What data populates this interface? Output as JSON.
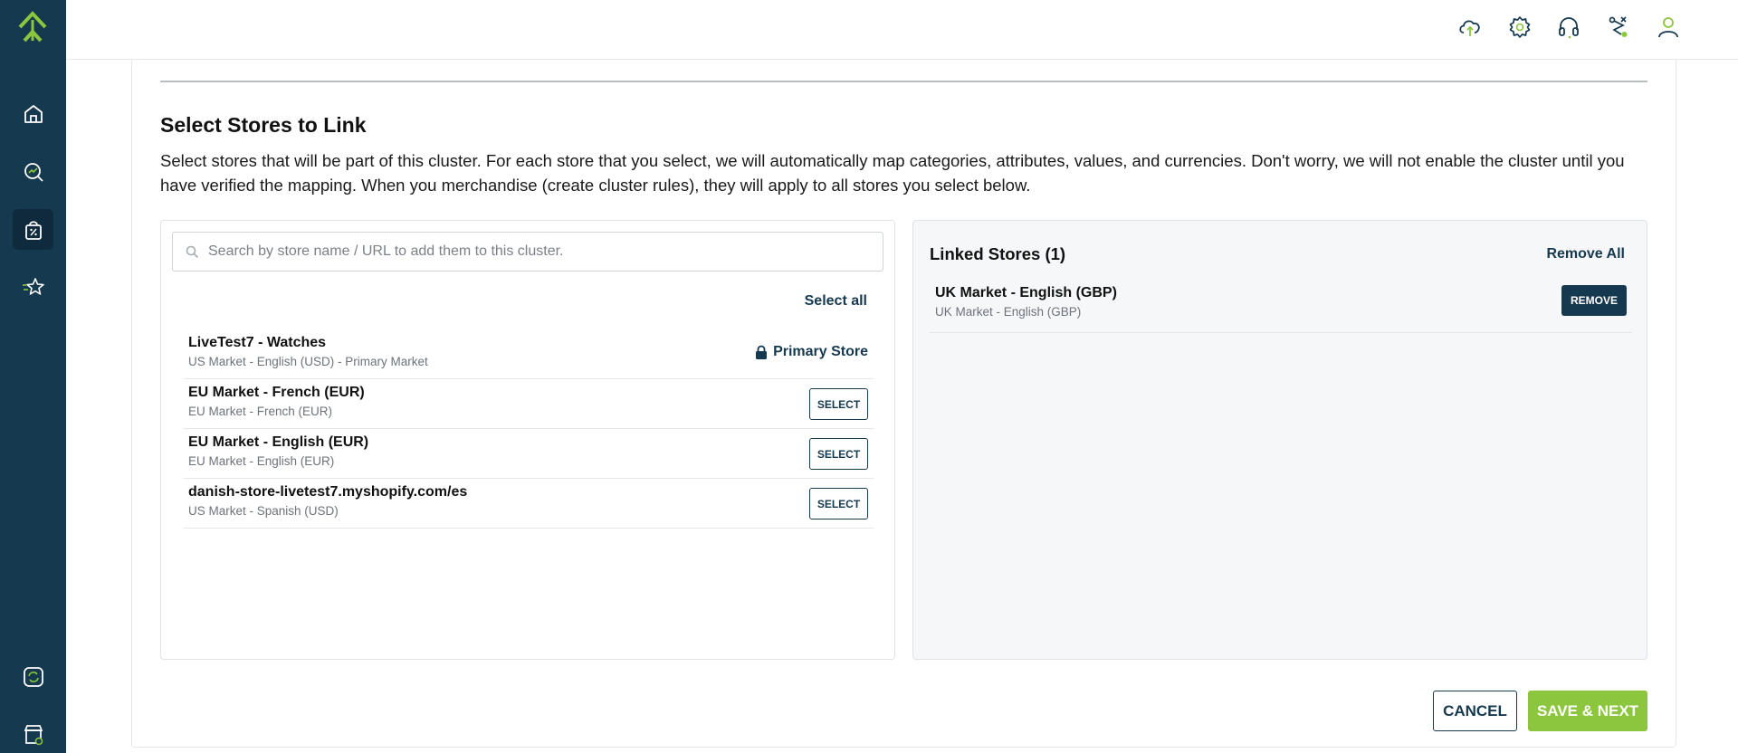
{
  "colors": {
    "sidebar_bg": "#15394f",
    "accent_green": "#8cc63f",
    "primary_dark": "#15394f"
  },
  "sidebar": {
    "logo": "chevron-up-logo-icon",
    "items": [
      {
        "icon": "home-icon",
        "active": false
      },
      {
        "icon": "analytics-search-icon",
        "active": false
      },
      {
        "icon": "shopping-bag-percent-icon",
        "active": true
      },
      {
        "icon": "star-list-icon",
        "active": false
      },
      {
        "icon": "sync-icon",
        "active": false
      },
      {
        "icon": "store-settings-icon",
        "active": false
      }
    ]
  },
  "header": {
    "icons": [
      "cloud-upload-icon",
      "gear-icon",
      "headset-icon",
      "route-icon",
      "user-icon"
    ]
  },
  "main": {
    "title": "Select Stores to Link",
    "description": "Select stores that will be part of this cluster. For each store that you select, we will automatically map categories, attributes, values, and currencies. Don't worry, we will not enable the cluster until you have verified the mapping. When you merchandise (create cluster rules), they will apply to all stores you select below."
  },
  "available": {
    "search_placeholder": "Search by store name / URL to add them to this cluster.",
    "select_all_label": "Select all",
    "primary_label": "Primary Store",
    "select_label": "SELECT",
    "stores": [
      {
        "name": "LiveTest7 - Watches",
        "sub": "US Market - English (USD) - Primary Market",
        "primary": true
      },
      {
        "name": "EU Market - French (EUR)",
        "sub": "EU Market - French (EUR)",
        "primary": false
      },
      {
        "name": "EU Market - English (EUR)",
        "sub": "EU Market - English (EUR)",
        "primary": false
      },
      {
        "name": "danish-store-livetest7.myshopify.com/es",
        "sub": "US Market - Spanish (USD)",
        "primary": false
      }
    ]
  },
  "linked": {
    "title": "Linked Stores (1)",
    "remove_all_label": "Remove All",
    "remove_label": "REMOVE",
    "stores": [
      {
        "name": "UK Market - English (GBP)",
        "sub": "UK Market - English (GBP)"
      }
    ]
  },
  "footer": {
    "cancel_label": "CANCEL",
    "save_label": "SAVE & NEXT"
  }
}
